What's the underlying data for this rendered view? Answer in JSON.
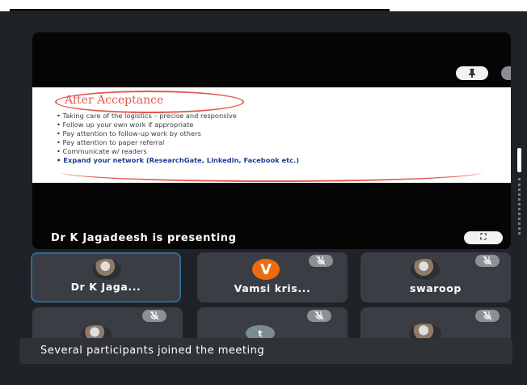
{
  "meeting": {
    "presenting_text": "Dr K Jagadeesh is presenting",
    "pin_icon": "pin-icon",
    "mute_icon": "mic-off-icon",
    "fullscreen_icon": "fullscreen-icon"
  },
  "slide": {
    "title": "After Acceptance",
    "bullets": [
      "Taking care of the logistics – precise and responsive",
      "Follow up your own work if appropriate",
      "Pay attention to follow-up work by others",
      "Pay attention to paper referral",
      "Communicate w/ readers",
      "Expand your network (ResearchGate, Linkedin, Facebook etc.)"
    ]
  },
  "participants": [
    {
      "name": "Dr K Jaga...",
      "avatar": "photo",
      "muted": false,
      "active": true
    },
    {
      "name": "Vamsi kris...",
      "avatar": "letter",
      "initial": "V",
      "muted": true,
      "active": false
    },
    {
      "name": "swaroop",
      "avatar": "photo",
      "muted": true,
      "active": false
    },
    {
      "name": "",
      "avatar": "photo",
      "muted": true,
      "active": false
    },
    {
      "name": "",
      "avatar": "letter",
      "initial": "t",
      "muted": true,
      "active": false
    },
    {
      "name": "",
      "avatar": "photo",
      "muted": true,
      "active": false
    }
  ],
  "toast": {
    "text": "Several participants joined the meeting"
  },
  "colors": {
    "background": "#1f2328",
    "slide_title": "#e15a4e",
    "highlight_bullet": "#1c3f8f",
    "active_border": "#2b6b94",
    "avatar_v": "#f06a0f"
  }
}
